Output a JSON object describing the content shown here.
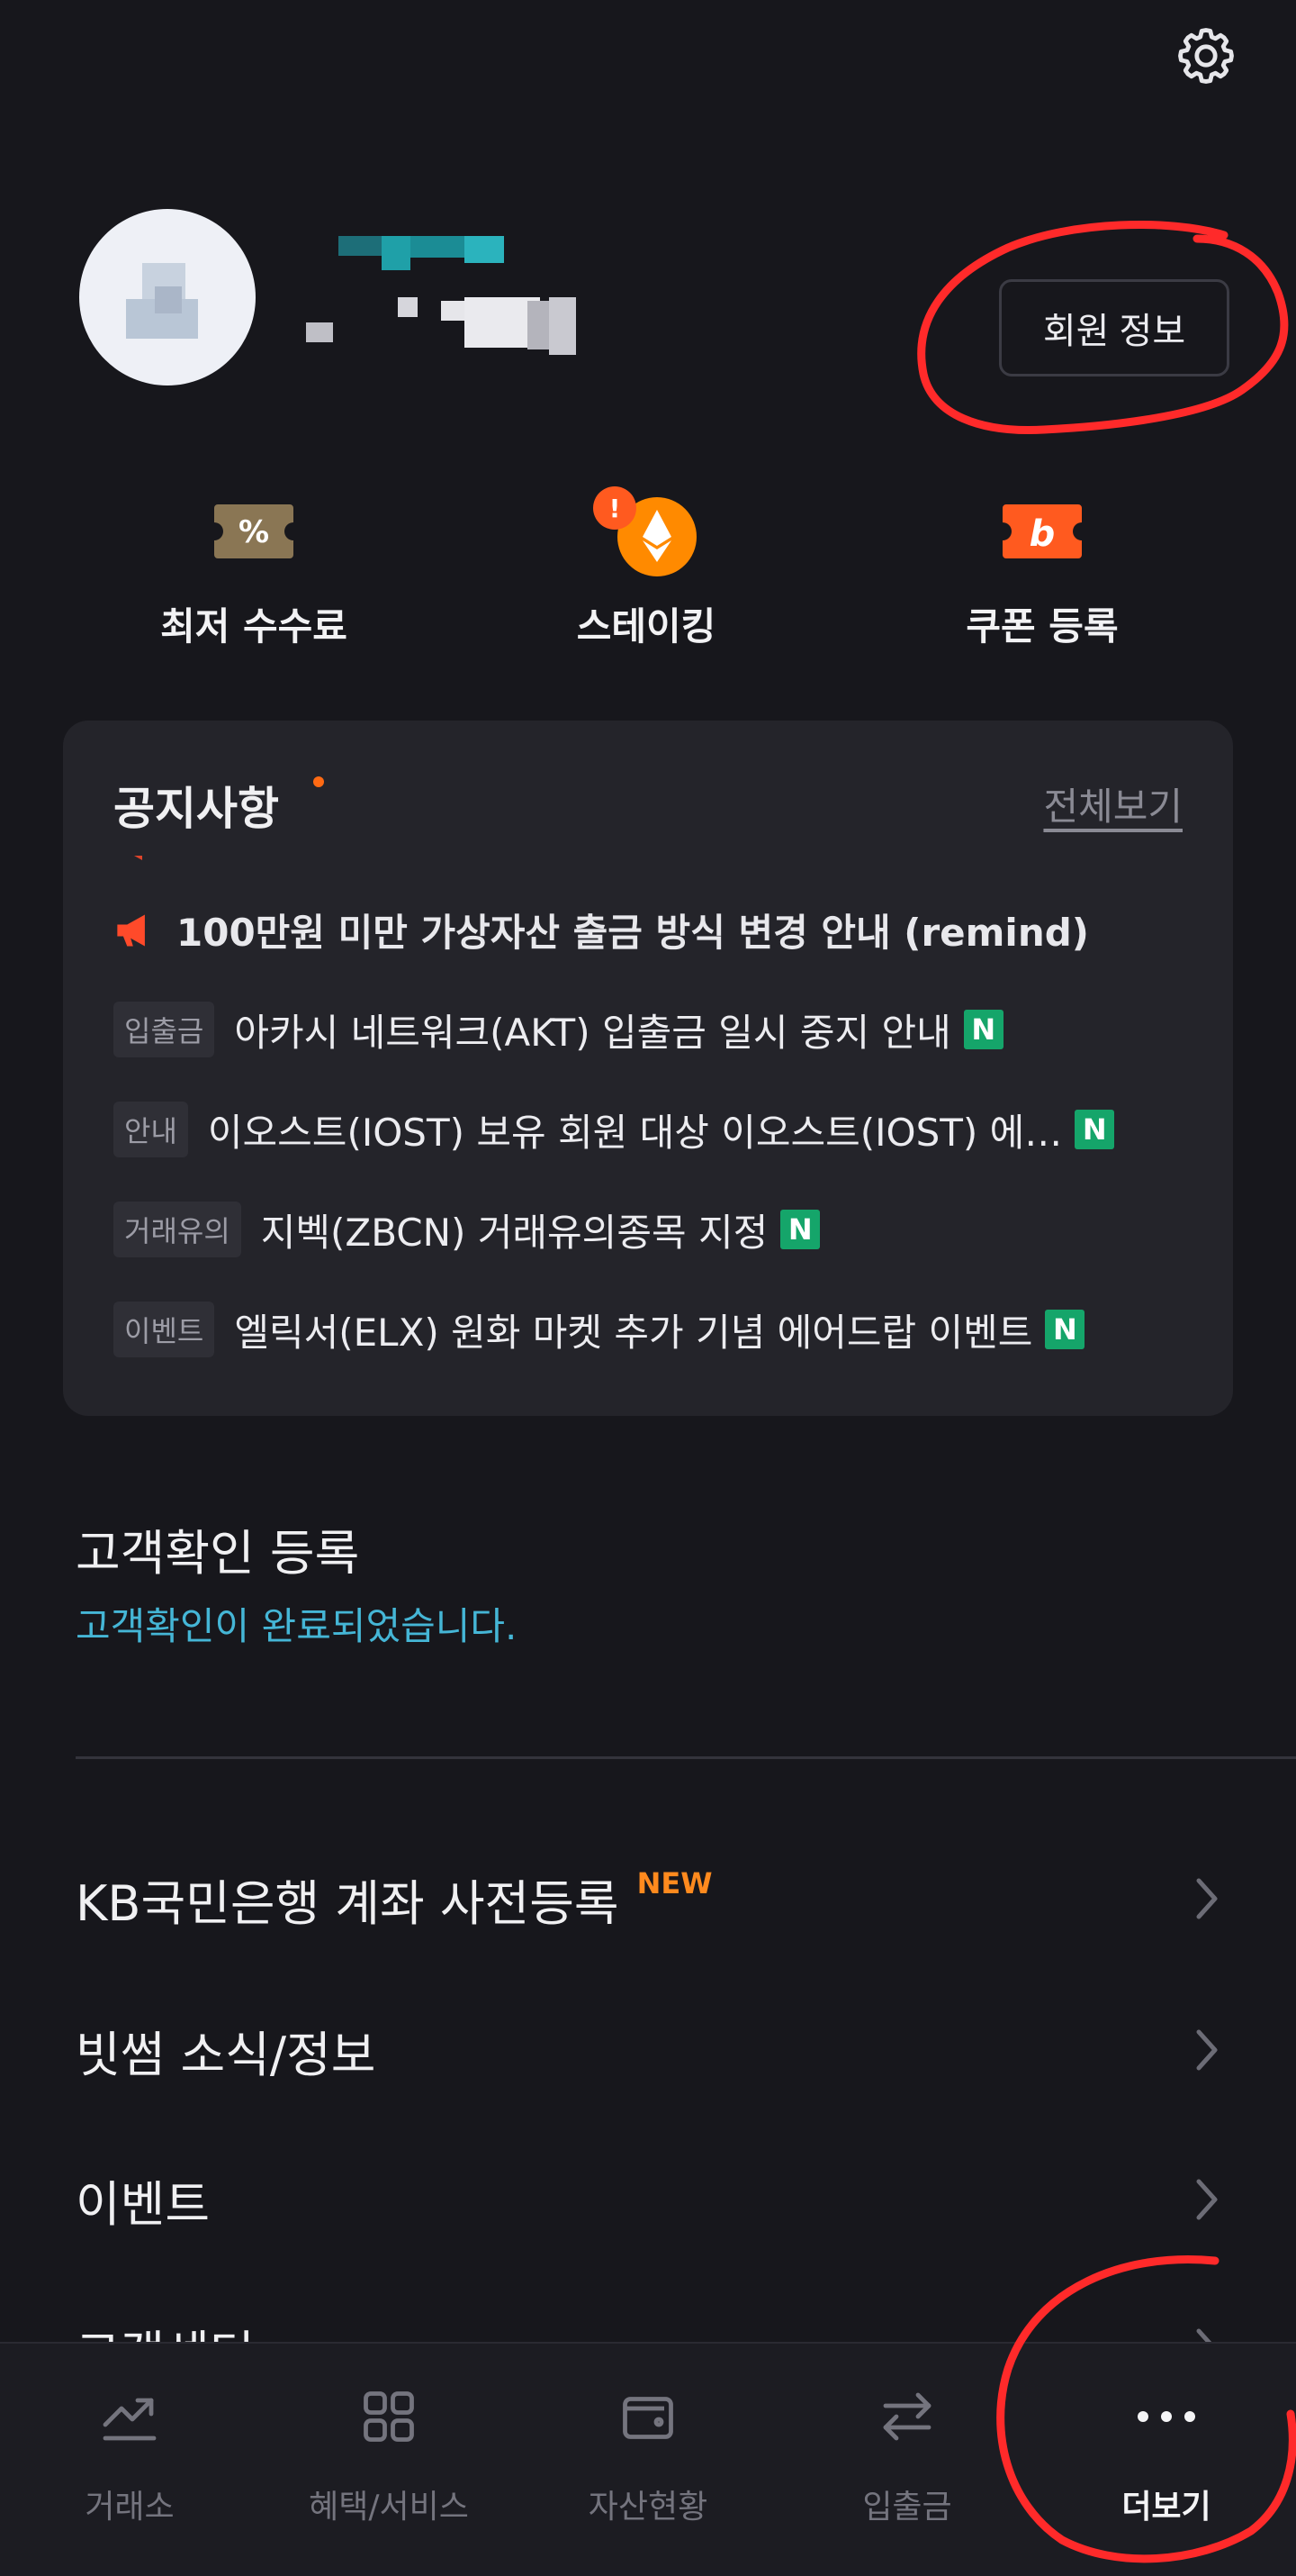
{
  "header": {
    "settings_icon": "gear-icon",
    "profile_name": "",
    "member_info_label": "회원 정보"
  },
  "quick_menu": [
    {
      "label": "최저 수수료",
      "icon": "percent-ticket-icon",
      "color": "#8a7654"
    },
    {
      "label": "스테이킹",
      "icon": "ethereum-coin-icon",
      "color": "#ff8a00",
      "alert_badge": "!"
    },
    {
      "label": "쿠폰 등록",
      "icon": "coupon-icon",
      "color": "#ff5a1f"
    }
  ],
  "notice": {
    "title": "공지사항",
    "view_all": "전체보기",
    "ticker": "100만원 미만 가상자산 출금 방식 변경 안내 (remind)",
    "items": [
      {
        "tag": "입출금",
        "text": "아카시 네트워크(AKT) 입출금 일시 중지 안내",
        "badge": "N"
      },
      {
        "tag": "안내",
        "text": "이오스트(IOST) 보유 회원 대상 이오스트(IOST) 에…",
        "badge": "N"
      },
      {
        "tag": "거래유의",
        "text": "지벡(ZBCN) 거래유의종목 지정",
        "badge": "N"
      },
      {
        "tag": "이벤트",
        "text": "엘릭서(ELX) 원화 마켓 추가 기념 에어드랍 이벤트",
        "badge": "N"
      }
    ]
  },
  "kyc": {
    "title": "고객확인 등록",
    "status": "고객확인이 완료되었습니다."
  },
  "menu": [
    {
      "label": "KB국민은행 계좌 사전등록",
      "badge": "NEW"
    },
    {
      "label": "빗썸 소식/정보"
    },
    {
      "label": "이벤트"
    },
    {
      "label": "고객센터"
    }
  ],
  "bottom_nav": [
    {
      "label": "거래소",
      "icon": "trend-chart-icon"
    },
    {
      "label": "혜택/서비스",
      "icon": "grid-icon"
    },
    {
      "label": "자산현황",
      "icon": "wallet-icon"
    },
    {
      "label": "입출금",
      "icon": "transfer-arrows-icon"
    },
    {
      "label": "더보기",
      "icon": "more-dots-icon",
      "active": true
    }
  ],
  "colors": {
    "background": "#17171c",
    "card": "#24242a",
    "accent_orange": "#ff8a1e",
    "new_badge_green": "#15a56a",
    "kyc_status_blue": "#45b6d6",
    "annotation_red": "#ff2a2a"
  }
}
